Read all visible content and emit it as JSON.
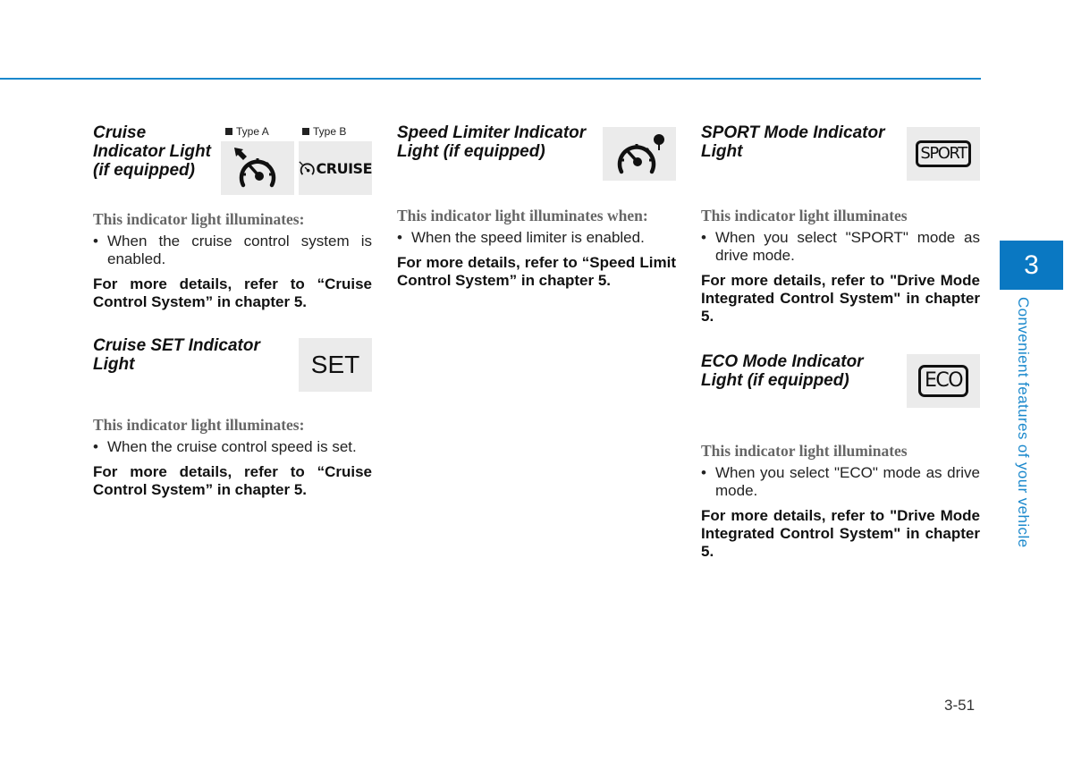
{
  "page": {
    "number": "3-51",
    "chapter_number": "3",
    "chapter_title": "Convenient features of your vehicle",
    "accent_color": "#1a88cc"
  },
  "sections": {
    "cruise": {
      "title_lines": [
        "Cruise",
        "Indicator Light",
        "(if equipped)"
      ],
      "type_a_label": "Type A",
      "type_b_label": "Type B",
      "type_a_icon": "cruise-speedometer-arrow-icon",
      "type_b_icon": "cruise-text-icon",
      "type_b_icon_text": "CRUISE",
      "label": "This indicator light illuminates:",
      "bullets": [
        "When the cruise control system is enabled."
      ],
      "reference": "For more details, refer to “Cruise Control System” in chapter 5."
    },
    "cruise_set": {
      "title_lines": [
        "Cruise SET Indicator",
        "Light"
      ],
      "icon_text": "SET",
      "label": "This indicator light illuminates:",
      "bullets": [
        "When the cruise control speed is set."
      ],
      "reference": "For more details, refer to “Cruise Control System” in chapter 5."
    },
    "speed_limiter": {
      "title_lines": [
        "Speed Limiter Indicator",
        "Light (if equipped)"
      ],
      "icon": "speed-limiter-speedometer-icon",
      "label": "This indicator light illuminates when:",
      "bullets": [
        "When the speed limiter is enabled."
      ],
      "reference": "For more details, refer to “Speed Limit Control System” in chapter 5."
    },
    "sport": {
      "title_lines": [
        "SPORT Mode Indicator",
        "Light"
      ],
      "icon_text": "SPORT",
      "label": "This indicator light illuminates",
      "bullets": [
        "When you select \"SPORT\" mode as drive mode."
      ],
      "reference": "For more details, refer to \"Drive Mode Integrated Control System\" in chapter 5."
    },
    "eco": {
      "title_lines": [
        "ECO Mode Indicator",
        "Light (if equipped)"
      ],
      "icon_text": "ECO",
      "label": "This indicator light illuminates",
      "bullets": [
        "When you select \"ECO\" mode as drive mode."
      ],
      "reference": "For more details, refer to \"Drive Mode Integrated Control System\" in chapter 5."
    }
  }
}
